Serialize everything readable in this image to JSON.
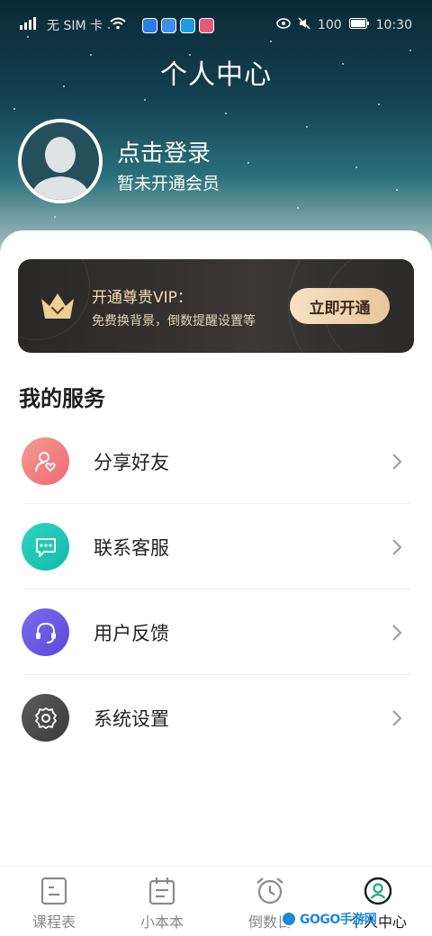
{
  "status_bar": {
    "left_text": "无 SIM 卡",
    "battery": "100",
    "time": "10:30"
  },
  "header": {
    "title": "个人中心",
    "login_text": "点击登录",
    "member_status": "暂未开通会员"
  },
  "vip": {
    "title": "开通尊贵VIP：",
    "description": "免费换背景，倒数提醒设置等",
    "button_label": "立即开通",
    "icon": "crown-icon"
  },
  "services": {
    "title": "我的服务",
    "items": [
      {
        "label": "分享好友",
        "icon": "user-heart-icon",
        "color": "#f07a7a"
      },
      {
        "label": "联系客服",
        "icon": "message-dots-icon",
        "color": "#1fc9b4"
      },
      {
        "label": "用户反馈",
        "icon": "headset-icon",
        "color": "#6b5be6"
      },
      {
        "label": "系统设置",
        "icon": "gear-icon",
        "color": "#4a4a4a"
      }
    ]
  },
  "tabbar": {
    "items": [
      {
        "label": "课程表",
        "icon": "schedule-icon",
        "active": false
      },
      {
        "label": "小本本",
        "icon": "notebook-icon",
        "active": false
      },
      {
        "label": "倒数日",
        "icon": "alarm-clock-icon",
        "active": false
      },
      {
        "label": "个人中心",
        "icon": "profile-icon",
        "active": true
      }
    ]
  },
  "watermark": {
    "text": "GOGO手游网"
  }
}
